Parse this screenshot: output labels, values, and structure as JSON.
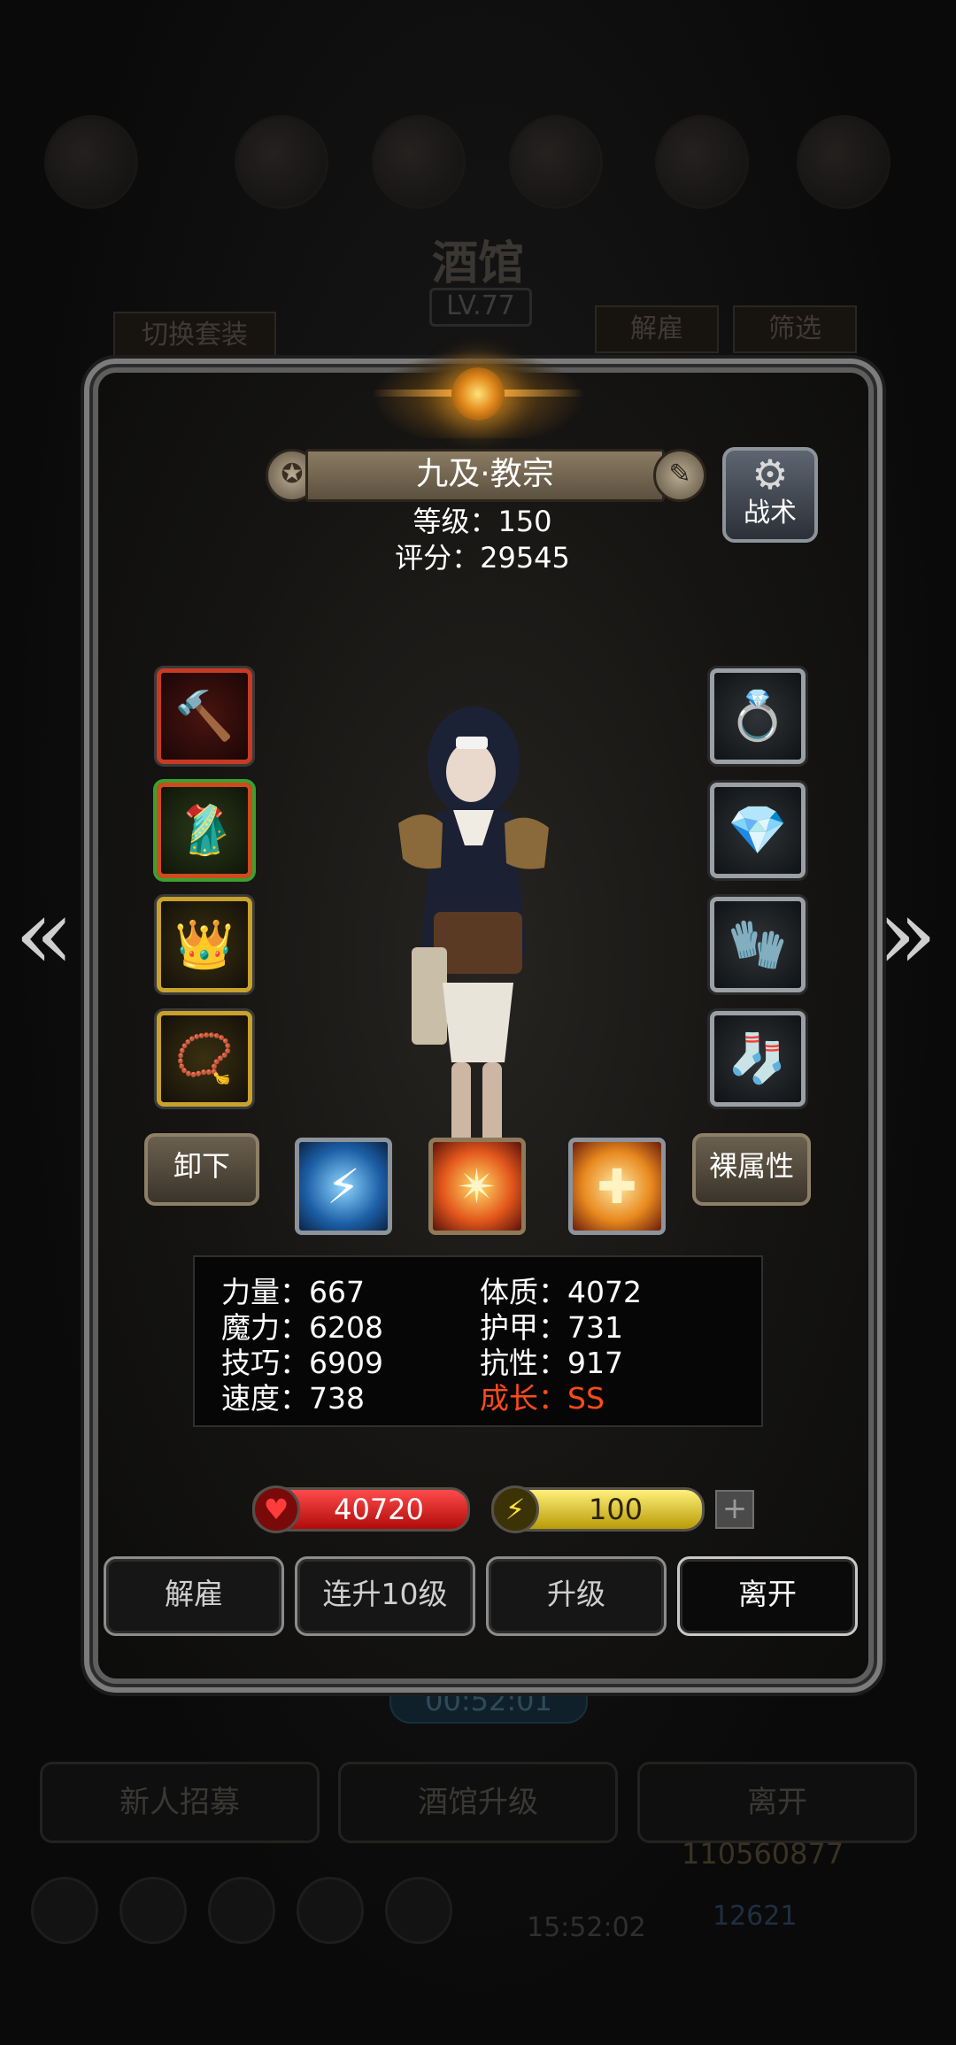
{
  "background": {
    "title": "酒馆",
    "level": "LV.77",
    "switch_outfit": "切换套装",
    "dismiss": "解雇",
    "filter": "筛选",
    "timer": "00:52:01",
    "recruit": "新人招募",
    "upgrade_tavern": "酒馆升级",
    "leave": "离开",
    "gold": "110560877",
    "clock": "15:52:02",
    "gems": "12621"
  },
  "hero": {
    "name": "九及·教宗",
    "level_line": "等级：150",
    "score_line": "评分：29545",
    "tactics_label": "战术"
  },
  "equipment_left": [
    {
      "name": "hammer-icon",
      "glyph": "🔨",
      "quality": "red"
    },
    {
      "name": "robe-icon",
      "glyph": "🥻",
      "quality": "green"
    },
    {
      "name": "crown-icon",
      "glyph": "👑",
      "quality": "gold"
    },
    {
      "name": "amulet-icon",
      "glyph": "📿",
      "quality": "gold"
    }
  ],
  "equipment_right": [
    {
      "name": "ring-icon",
      "glyph": "💍",
      "quality": "gray"
    },
    {
      "name": "crystal-icon",
      "glyph": "💎",
      "quality": "gray"
    },
    {
      "name": "mail-glove-icon",
      "glyph": "🧤",
      "quality": "gray"
    },
    {
      "name": "mail-boot-icon",
      "glyph": "🧦",
      "quality": "gray"
    }
  ],
  "actions": {
    "unequip": "卸下",
    "base_attributes": "裸属性"
  },
  "skills": [
    {
      "name": "lightning-skill-icon",
      "glyph": "⚡"
    },
    {
      "name": "radiant-star-skill-icon",
      "glyph": "✴"
    },
    {
      "name": "holy-cross-skill-icon",
      "glyph": "✚"
    }
  ],
  "stats": {
    "strength": "力量：667",
    "magic": "魔力：6208",
    "skill": "技巧：6909",
    "speed": "速度：738",
    "constitution": "体质：4072",
    "armor": "护甲：731",
    "resistance": "抗性：917",
    "growth": "成长：SS"
  },
  "bars": {
    "hp": "40720",
    "mp": "100"
  },
  "buttons": {
    "dismiss": "解雇",
    "level_up_10": "连升10级",
    "level_up": "升级",
    "leave": "离开"
  },
  "colors": {
    "growth": "#ff4a1a",
    "hp_bar": "#d01818",
    "mp_bar": "#e0c814"
  }
}
